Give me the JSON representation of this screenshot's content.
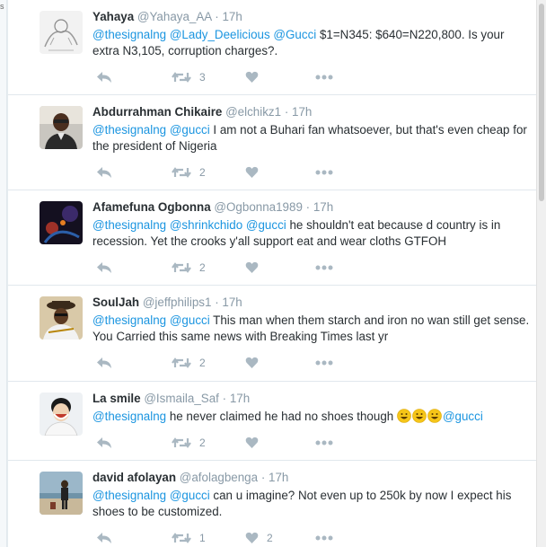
{
  "edge": {
    "label": "s"
  },
  "tweets": [
    {
      "name": "Yahaya",
      "handle": "@Yahaya_AA",
      "time": "17h",
      "mentions": [
        "@thesignalng",
        "@Lady_Deelicious",
        "@Gucci"
      ],
      "text": " $1=N345: $640=N220,800. Is your extra N3,105, corruption charges?.",
      "retweets": "3",
      "likes": ""
    },
    {
      "name": "Abdurrahman Chikaire",
      "handle": "@elchikz1",
      "time": "17h",
      "mentions": [
        "@thesignalng",
        "@gucci"
      ],
      "text": " I am not a Buhari fan whatsoever, but that's even cheap for the president of Nigeria",
      "retweets": "2",
      "likes": ""
    },
    {
      "name": "Afamefuna Ogbonna",
      "handle": "@Ogbonna1989",
      "time": "17h",
      "mentions": [
        "@thesignalng",
        "@shrinkchido",
        "@gucci"
      ],
      "text": " he shouldn't eat because d country is in recession. Yet the crooks y'all support eat and wear cloths GTFOH",
      "retweets": "2",
      "likes": ""
    },
    {
      "name": "SoulJah",
      "handle": "@jeffphilips1",
      "time": "17h",
      "mentions": [
        "@thesignalng",
        "@gucci"
      ],
      "text": " This man when them starch and iron no wan still get sense. You Carried this same news with Breaking Times last yr",
      "retweets": "2",
      "likes": ""
    },
    {
      "name": "La smile",
      "handle": "@Ismaila_Saf",
      "time": "17h",
      "mentions": [
        "@thesignalng"
      ],
      "text": " he never claimed he had no shoes though ",
      "trailing_mention": "@gucci",
      "emojis": [
        "grinning-face",
        "grinning-face",
        "grinning-face"
      ],
      "retweets": "2",
      "likes": ""
    },
    {
      "name": "david afolayan",
      "handle": "@afolagbenga",
      "time": "17h",
      "mentions": [
        "@thesignalng",
        "@gucci"
      ],
      "text": " can u imagine? Not even up to 250k by now I expect his shoes to be customized.",
      "retweets": "1",
      "likes": "2"
    }
  ],
  "separator": "·",
  "icons": {
    "reply": "reply-icon",
    "retweet": "retweet-icon",
    "like": "heart-icon",
    "more": "more-dots-icon"
  },
  "colors": {
    "link": "#1b95e0",
    "muted": "#8899a6",
    "icon": "#aab8c2",
    "border": "#e1e8ed"
  }
}
